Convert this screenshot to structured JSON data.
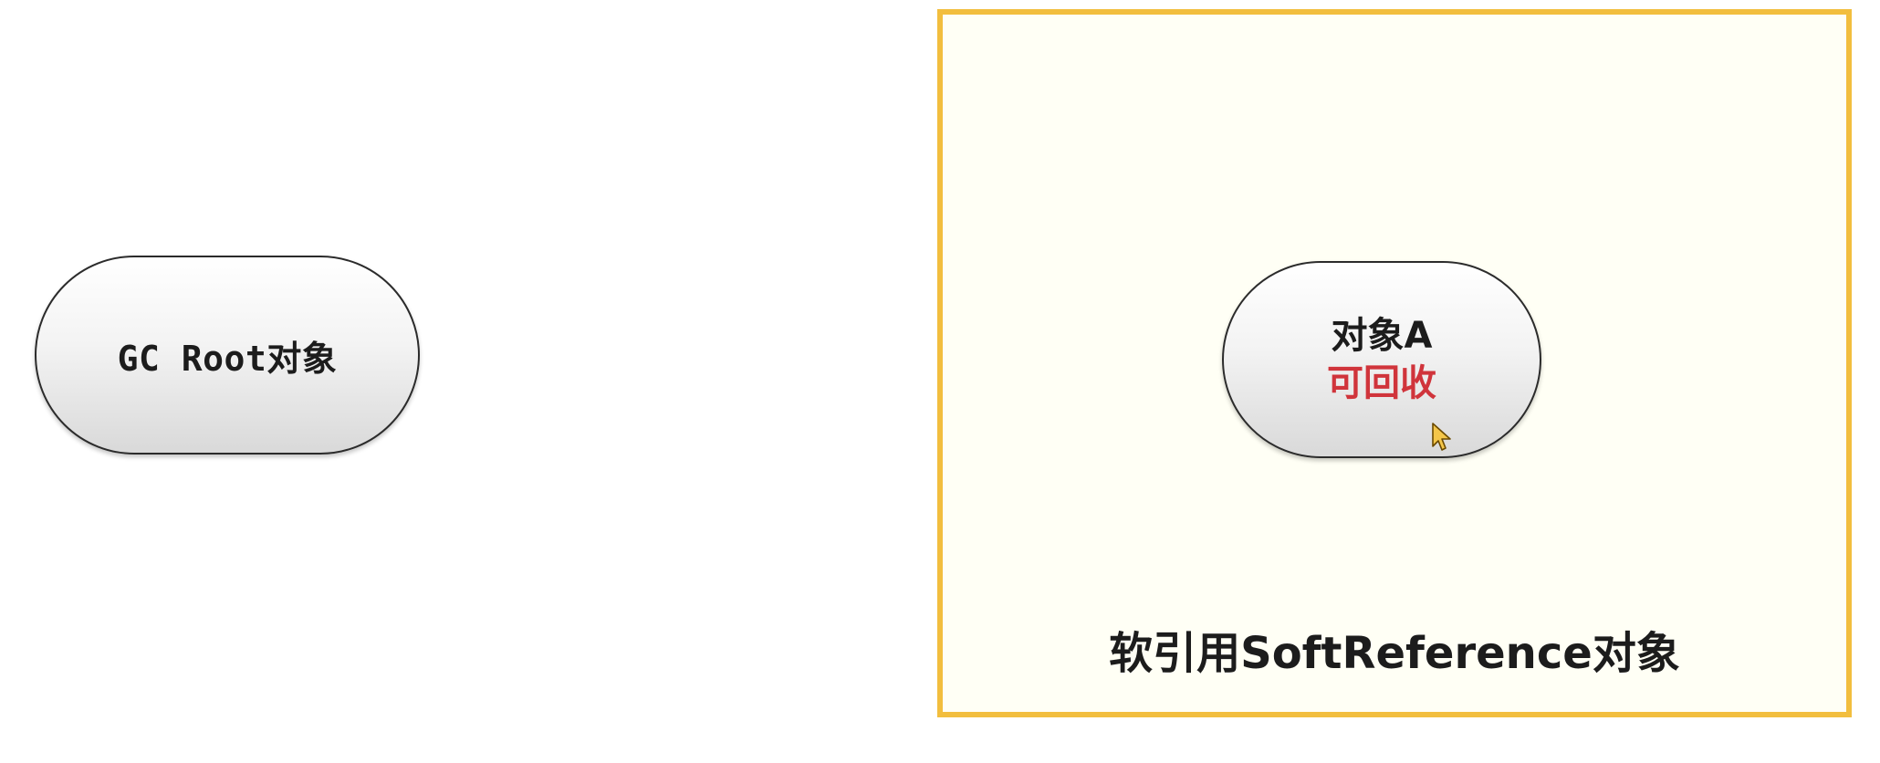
{
  "gc_root": {
    "label": "GC Root对象"
  },
  "soft_reference": {
    "label": "软引用SoftReference对象",
    "border_color": "#f2be3e",
    "fill_color": "#fffff5"
  },
  "object_a": {
    "name": "对象A",
    "status": "可回收",
    "status_color": "#d0343b"
  },
  "cursor": {
    "icon": "pointer-cursor-icon"
  }
}
